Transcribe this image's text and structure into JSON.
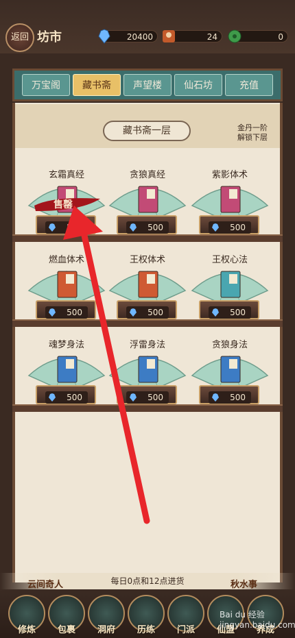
{
  "header": {
    "back_label": "返回",
    "title": "坊市"
  },
  "resources": [
    {
      "icon": "crystal-icon",
      "value": "20400"
    },
    {
      "icon": "character-token-icon",
      "value": "24"
    },
    {
      "icon": "jade-coin-icon",
      "value": "0"
    }
  ],
  "tabs": [
    {
      "label": "万宝阁"
    },
    {
      "label": "藏书斋"
    },
    {
      "label": "声望楼"
    },
    {
      "label": "仙石坊"
    },
    {
      "label": "充值"
    }
  ],
  "floor": {
    "label": "藏书斋一层",
    "unlock_text": "金丹一阶\n解锁下层"
  },
  "items": [
    {
      "name": "玄霜真经",
      "price": "500",
      "book_color": "#c24b76",
      "sold_label": "售罄"
    },
    {
      "name": "贪狼真经",
      "price": "500",
      "book_color": "#c24b76"
    },
    {
      "name": "紫影体术",
      "price": "500",
      "book_color": "#c24b76"
    },
    {
      "name": "燃血体术",
      "price": "500",
      "book_color": "#cf5a33"
    },
    {
      "name": "王权体术",
      "price": "500",
      "book_color": "#cf5a33"
    },
    {
      "name": "王权心法",
      "price": "500",
      "book_color": "#4aa6b0"
    },
    {
      "name": "魂梦身法",
      "price": "500",
      "book_color": "#3d7cc4"
    },
    {
      "name": "浮雷身法",
      "price": "500",
      "book_color": "#3d7cc4"
    },
    {
      "name": "贪狼身法",
      "price": "500",
      "book_color": "#3d7cc4"
    }
  ],
  "restock_text": "每日0点和12点进货",
  "corners": {
    "left": "云间奇人",
    "right": "秋水事"
  },
  "nav": [
    {
      "label": "修炼"
    },
    {
      "label": "包裹"
    },
    {
      "label": "洞府"
    },
    {
      "label": "历练"
    },
    {
      "label": "门派"
    },
    {
      "label": "仙盟"
    },
    {
      "label": "养成"
    }
  ],
  "watermark": "Bai du 经验  jingyan.baidu.com"
}
